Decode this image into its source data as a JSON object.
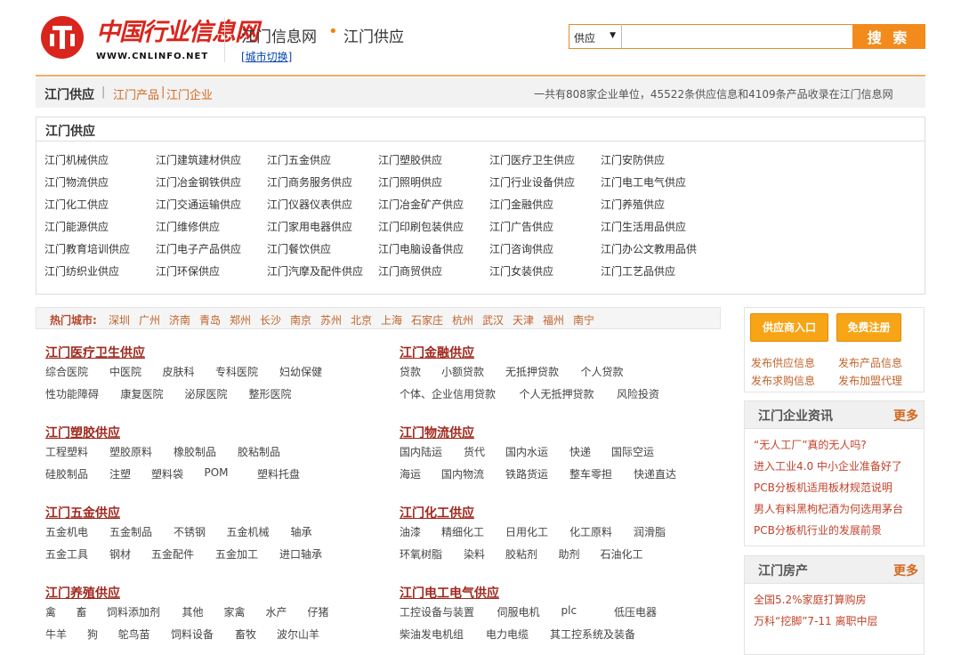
{
  "header": {
    "logo_cn": "中国行业信息网",
    "logo_url": "WWW.CNLINFO.NET",
    "site_name": "江门信息网",
    "site_dot": "•",
    "site_section": "江门供应",
    "city_switch": "[城市切换]",
    "search": {
      "select_value": "供应",
      "placeholder": "",
      "button": "搜 索"
    }
  },
  "breadcrumb": {
    "current": "江门供应",
    "sep": "|",
    "link1": "江门产品",
    "sep2": "|",
    "link2": "江门企业",
    "stat": "一共有808家企业单位，45522条供应信息和4109条产品收录在江门信息网"
  },
  "supply": {
    "title": "江门供应",
    "rows": [
      [
        "江门机械供应",
        "江门建筑建材供应",
        "江门五金供应",
        "江门塑胶供应",
        "江门医疗卫生供应",
        "江门安防供应"
      ],
      [
        "江门物流供应",
        "江门冶金钢铁供应",
        "江门商务服务供应",
        "江门照明供应",
        "江门行业设备供应",
        "江门电工电气供应"
      ],
      [
        "江门化工供应",
        "江门交通运输供应",
        "江门仪器仪表供应",
        "江门冶金矿产供应",
        "江门金融供应",
        "江门养殖供应"
      ],
      [
        "江门能源供应",
        "江门维修供应",
        "江门家用电器供应",
        "江门印刷包装供应",
        "江门广告供应",
        "江门生活用品供应"
      ],
      [
        "江门教育培训供应",
        "江门电子产品供应",
        "江门餐饮供应",
        "江门电脑设备供应",
        "江门咨询供应",
        "江门办公文教用品供"
      ],
      [
        "江门纺织业供应",
        "江门环保供应",
        "江门汽摩及配件供应",
        "江门商贸供应",
        "江门女装供应",
        "江门工艺品供应"
      ]
    ]
  },
  "hot_cities": {
    "label": "热门城市:",
    "cities": [
      "深圳",
      "广州",
      "济南",
      "青岛",
      "郑州",
      "长沙",
      "南京",
      "苏州",
      "北京",
      "上海",
      "石家庄",
      "杭州",
      "武汉",
      "天津",
      "福州",
      "南宁"
    ]
  },
  "categories": [
    {
      "title": "江门医疗卫生供应",
      "rows": [
        [
          "综合医院",
          "中医院",
          "皮肤科",
          "专科医院",
          "妇幼保健"
        ],
        [
          "性功能障碍",
          "康复医院",
          "泌尿医院",
          "整形医院"
        ]
      ]
    },
    {
      "title": "江门金融供应",
      "rows": [
        [
          "贷款",
          "小额贷款",
          "无抵押贷款",
          "个人贷款"
        ],
        [
          "个体、企业信用贷款",
          "个人无抵押贷款",
          "风险投资"
        ]
      ]
    },
    {
      "title": "江门塑胶供应",
      "rows": [
        [
          "工程塑料",
          "塑胶原料",
          "橡胶制品",
          "胶粘制品"
        ],
        [
          "硅胶制品",
          "注塑",
          "塑料袋",
          "POM",
          "塑料托盘"
        ]
      ]
    },
    {
      "title": "江门物流供应",
      "rows": [
        [
          "国内陆运",
          "货代",
          "国内水运",
          "快递",
          "国际空运"
        ],
        [
          "海运",
          "国内物流",
          "铁路货运",
          "整车零担",
          "快递直达"
        ]
      ]
    },
    {
      "title": "江门五金供应",
      "rows": [
        [
          "五金机电",
          "五金制品",
          "不锈钢",
          "五金机械",
          "轴承"
        ],
        [
          "五金工具",
          "钢材",
          "五金配件",
          "五金加工",
          "进口轴承"
        ]
      ]
    },
    {
      "title": "江门化工供应",
      "rows": [
        [
          "油漆",
          "精细化工",
          "日用化工",
          "化工原料",
          "润滑脂"
        ],
        [
          "环氧树脂",
          "染料",
          "胶粘剂",
          "助剂",
          "石油化工"
        ]
      ]
    },
    {
      "title": "江门养殖供应",
      "rows": [
        [
          "禽",
          "畜",
          "饲料添加剂",
          "其他",
          "家禽",
          "水产",
          "仔猪"
        ],
        [
          "牛羊",
          "狗",
          "鸵鸟苗",
          "饲料设备",
          "畜牧",
          "波尔山羊"
        ]
      ]
    },
    {
      "title": "江门电工电气供应",
      "rows": [
        [
          "工控设备与装置",
          "伺服电机",
          "plc",
          "低压电器"
        ],
        [
          "柴油发电机组",
          "电力电缆",
          "其工控系统及装备"
        ]
      ]
    }
  ],
  "sidebar": {
    "btn_supplier": "供应商入口",
    "btn_register": "免费注册",
    "links": [
      "发布供应信息",
      "发布产品信息",
      "发布求购信息",
      "发布加盟代理"
    ],
    "news_panel": {
      "title": "江门企业资讯",
      "more": "更多",
      "items": [
        "“无人工厂”真的无人吗?",
        "进入工业4.0 中小企业准备好了",
        "PCB分板机适用板材规范说明",
        "男人有料黑枸杞酒为何选用茅台",
        "PCB分板机行业的发展前景"
      ]
    },
    "house_panel": {
      "title": "江门房产",
      "more": "更多",
      "items": [
        "全国5.2%家庭打算购房",
        "万科“挖脚”7-11 离职中层"
      ]
    }
  }
}
